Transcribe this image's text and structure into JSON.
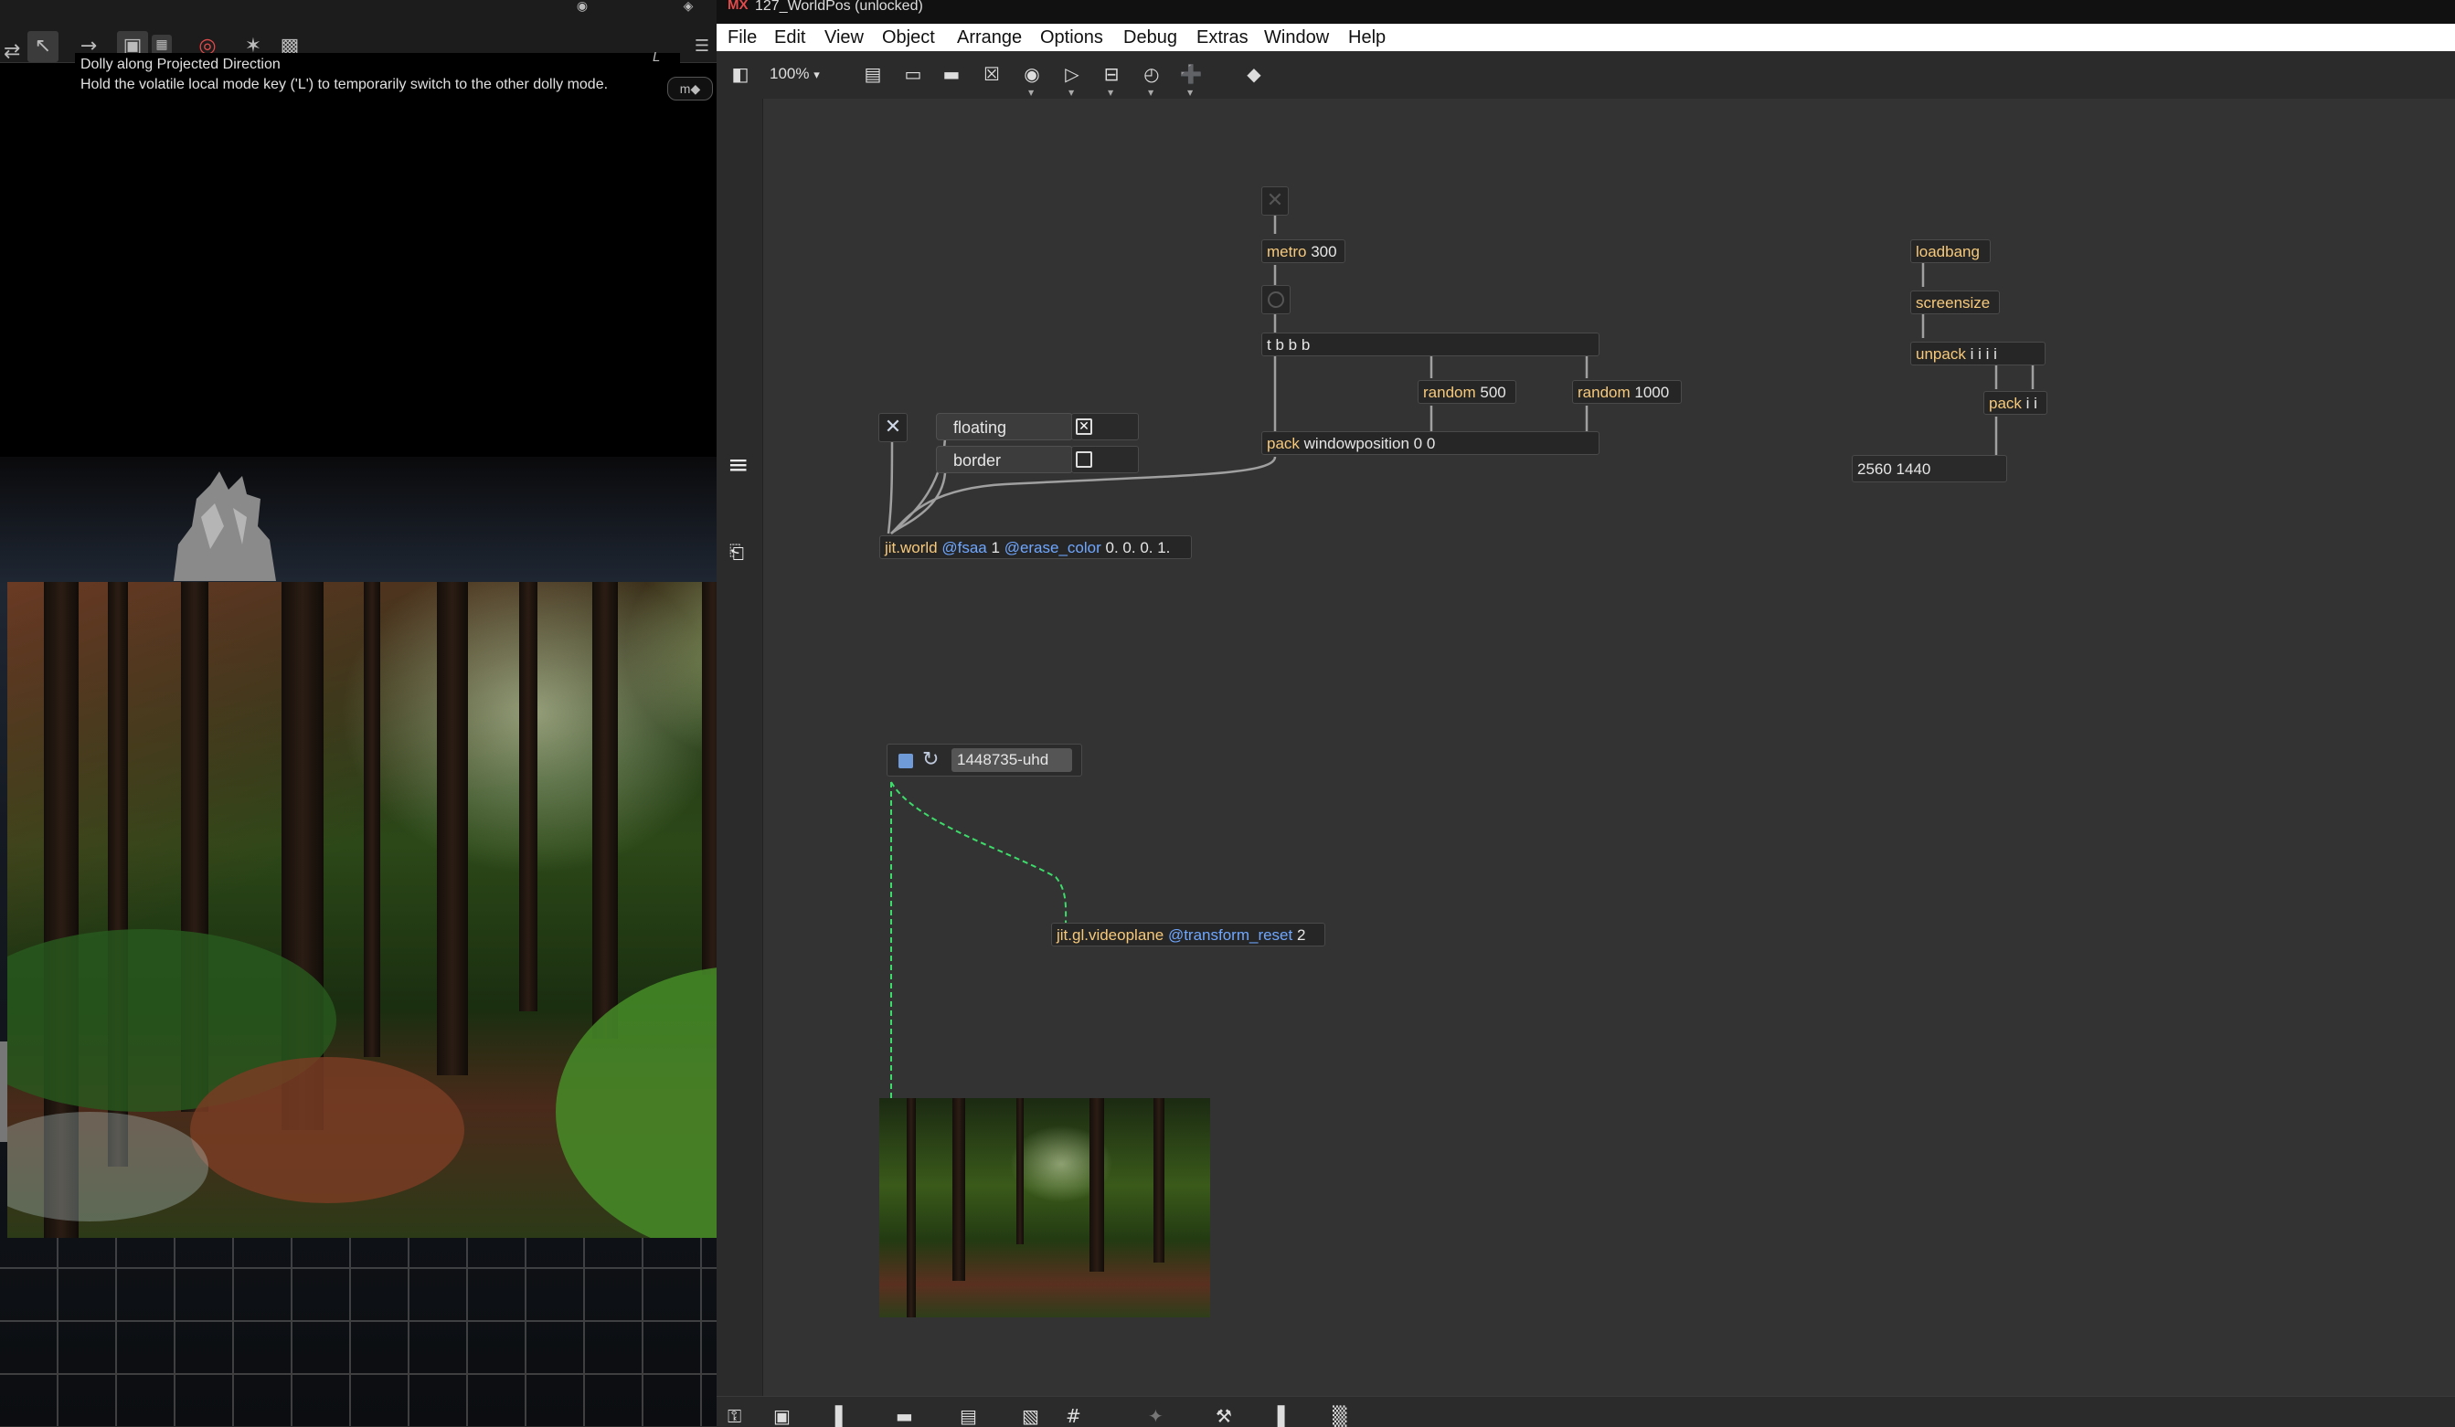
{
  "viewport": {
    "tooltip_title": "Dolly along Projected Direction",
    "tooltip_body": "Hold the volatile local mode key ('L') to temporarily switch to the other dolly mode.",
    "tooltip_key": "L",
    "mode_chip": "m◆"
  },
  "window": {
    "logo": "MX",
    "title": "127_WorldPos (unlocked)"
  },
  "menu": [
    "File",
    "Edit",
    "View",
    "Object",
    "Arrange",
    "Options",
    "Debug",
    "Extras",
    "Window",
    "Help"
  ],
  "toolbar": {
    "zoom": "100%",
    "zoom_caret": "▾"
  },
  "patcher": {
    "metro": {
      "cls": "metro",
      "arg": "300"
    },
    "trigger": {
      "cls": "t",
      "arg": "b b b"
    },
    "random1": {
      "cls": "random",
      "arg": "500"
    },
    "random2": {
      "cls": "random",
      "arg": "1000"
    },
    "pack_win": {
      "cls": "pack",
      "arg": "windowposition 0 0"
    },
    "floating_msg": "floating",
    "border_msg": "border",
    "floating_checked": "✕",
    "jit_world": {
      "cls": "jit.world",
      "a1": "@fsaa",
      "v1": "1",
      "a2": "@erase_color",
      "v2": "0. 0. 0. 1."
    },
    "loadbang": {
      "cls": "loadbang"
    },
    "screensize": {
      "cls": "screensize"
    },
    "unpack": {
      "cls": "unpack",
      "arg": "i i i i"
    },
    "pack_ii": {
      "cls": "pack",
      "arg": "i i"
    },
    "screensize_display": "2560 1440",
    "movie_name": "1448735-uhd",
    "videoplane": {
      "cls": "jit.gl.videoplane",
      "a1": "@transform_reset",
      "v1": "2"
    }
  },
  "colors": {
    "patcher_bg": "#333333",
    "object_class": "#f7c97a",
    "attribute": "#6fa7ff",
    "patch_cord": "#a0a0a0",
    "matrix_cord": "#3ddc6a"
  }
}
